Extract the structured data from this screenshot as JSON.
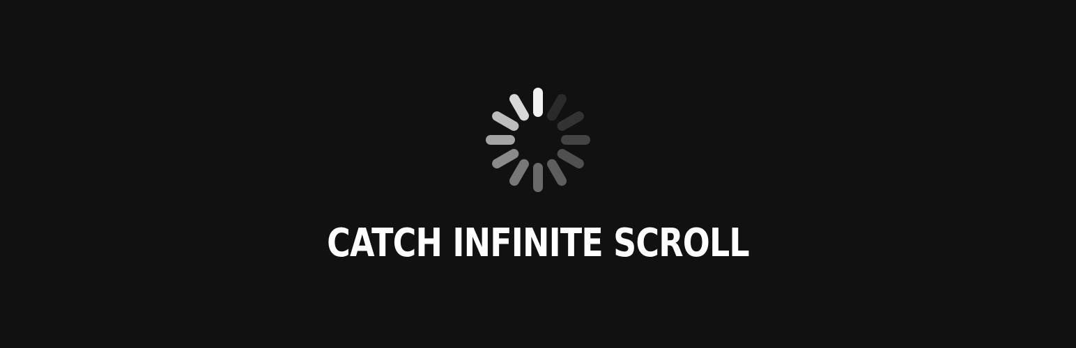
{
  "banner": {
    "title": "CATCH INFINITE SCROLL",
    "background_color": "#111111",
    "title_color": "#ffffff"
  },
  "spinner": {
    "icon": "loading-spinner-icon",
    "spoke_count": 12,
    "spoke_colors": [
      "#f2f2f2",
      "#2a2a2a",
      "#333333",
      "#444444",
      "#505050",
      "#5e5e5e",
      "#6a6a6a",
      "#787878",
      "#8a8a8a",
      "#a4a4a4",
      "#bdbdbd",
      "#d8d8d8"
    ]
  }
}
